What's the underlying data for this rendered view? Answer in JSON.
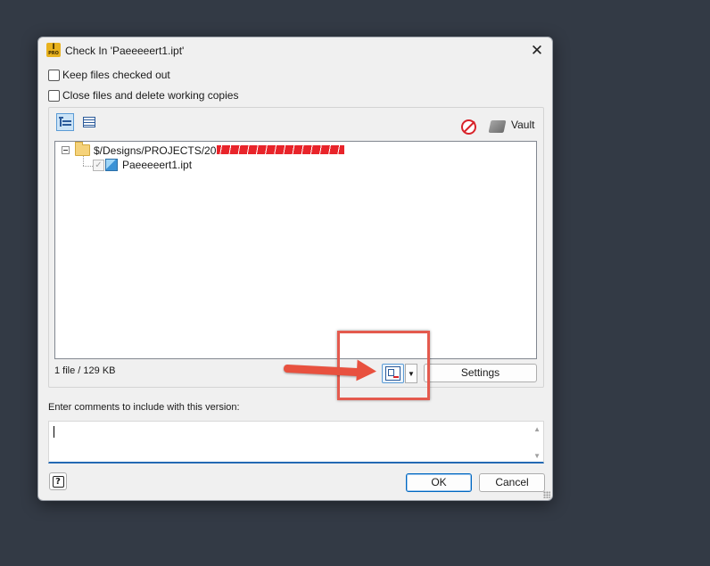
{
  "dialog": {
    "title": "Check In 'Paeeeeert1.ipt'",
    "app_icon_label": "I",
    "app_icon_sub": "PRO",
    "close_glyph": "✕"
  },
  "options": {
    "keep_checked_out": {
      "label": "Keep files checked out",
      "checked": false
    },
    "close_files": {
      "label": "Close files and delete working copies",
      "checked": false
    }
  },
  "toolbar": {
    "vault_label": "Vault"
  },
  "tree": {
    "folder_path": "$/Designs/PROJECTS/2023/23043 - ARTS - Portland, Wall",
    "folder_path_visible": "$/Designs/PROJECTS/2023/23",
    "file": {
      "name": "Paeeeeert1.ipt",
      "checked": true,
      "check_glyph": "✓"
    }
  },
  "footer": {
    "file_count": "1 file / 129 KB",
    "settings_label": "Settings",
    "split_arrow_glyph": "▼"
  },
  "comments": {
    "label": "Enter comments to include with this version:",
    "value": "",
    "scroll_up": "▲",
    "scroll_down": "▼"
  },
  "buttons": {
    "help_glyph": "?",
    "ok_label": "OK",
    "cancel_label": "Cancel"
  },
  "colors": {
    "background": "#333a45",
    "annotation": "#e45a4e",
    "accent": "#0067c0"
  }
}
